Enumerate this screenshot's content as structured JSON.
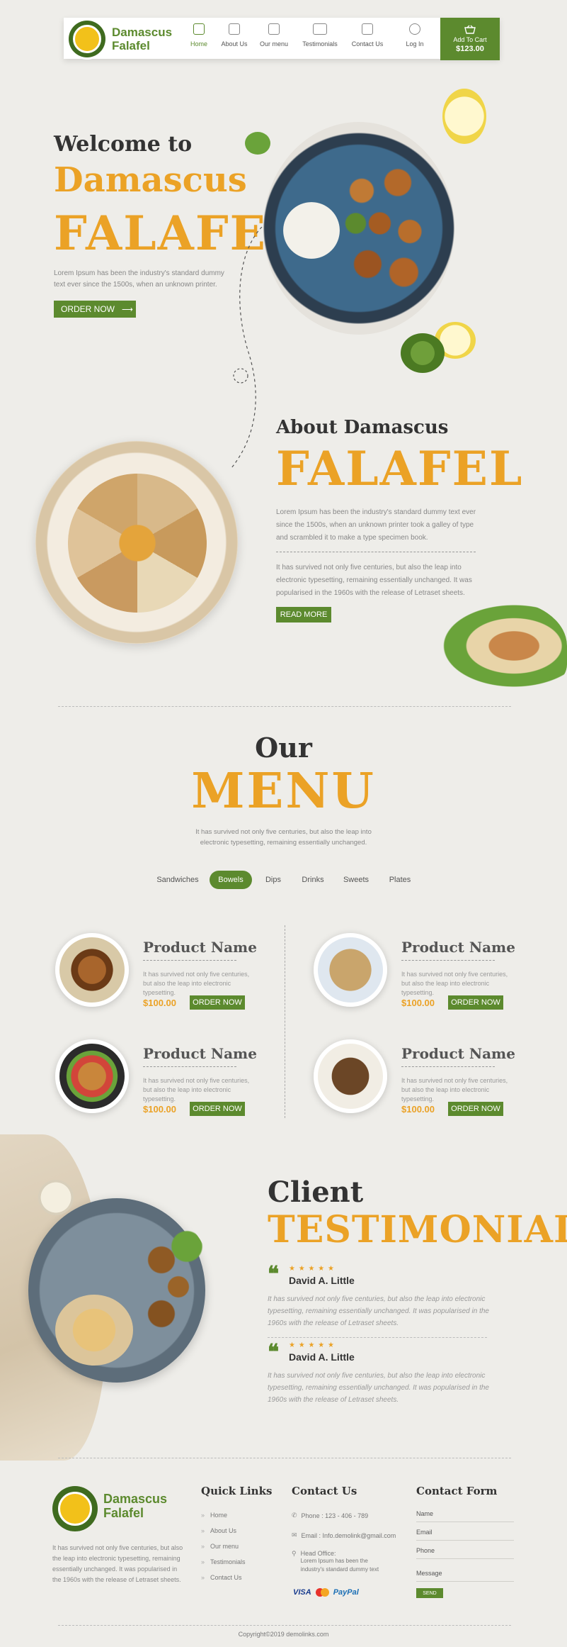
{
  "brand": {
    "name_line1": "Damascus",
    "name_line2": "Falafel"
  },
  "nav": [
    {
      "label": "Home",
      "icon": "home-icon",
      "active": true
    },
    {
      "label": "About Us",
      "icon": "document-icon"
    },
    {
      "label": "Our menu",
      "icon": "menu-jar-icon"
    },
    {
      "label": "Testimonials",
      "icon": "chat-icon"
    },
    {
      "label": "Contact Us",
      "icon": "phone-doc-icon"
    },
    {
      "label": "Log In",
      "icon": "user-circle-icon"
    }
  ],
  "cart": {
    "label": "Add To Cart",
    "amount": "$123.00"
  },
  "hero": {
    "welcome": "Welcome to",
    "title1": "Damascus",
    "title2": "FALAFEL",
    "text": "Lorem Ipsum has been the industry's standard dummy text ever since the 1500s, when an unknown printer.",
    "button": "ORDER NOW"
  },
  "about": {
    "heading": "About Damascus",
    "title": "FALAFEL",
    "text1": "Lorem Ipsum has been the industry's standard dummy text ever since the 1500s, when an unknown printer took a galley of type and scrambled it to make a type specimen book.",
    "text2": "It has survived not only five centuries, but also the leap into electronic typesetting, remaining essentially unchanged. It was popularised in the 1960s with the release of Letraset sheets.",
    "button": "READ MORE"
  },
  "menu": {
    "heading": "Our",
    "title": "MENU",
    "text": "It has survived not only five centuries, but also the leap into electronic typesetting, remaining essentially unchanged.",
    "tabs": [
      "Sandwiches",
      "Bowels",
      "Dips",
      "Drinks",
      "Sweets",
      "Plates"
    ],
    "active_tab": "Bowels",
    "products": [
      {
        "name": "Product Name",
        "desc": "It has survived not only five centuries, but also the leap into electronic typesetting.",
        "price": "$100.00",
        "button": "ORDER NOW"
      },
      {
        "name": "Product Name",
        "desc": "It has survived not only five centuries, but also the leap into electronic typesetting.",
        "price": "$100.00",
        "button": "ORDER NOW"
      },
      {
        "name": "Product Name",
        "desc": "It has survived not only five centuries, but also the leap into electronic typesetting.",
        "price": "$100.00",
        "button": "ORDER NOW"
      },
      {
        "name": "Product Name",
        "desc": "It has survived not only five centuries, but also the leap into electronic typesetting.",
        "price": "$100.00",
        "button": "ORDER NOW"
      }
    ]
  },
  "testimonials": {
    "heading": "Client",
    "title": "TESTIMONIALS",
    "items": [
      {
        "stars": "★ ★ ★ ★ ★",
        "name": "David A. Little",
        "text": "It has survived not only five centuries, but also the leap into electronic typesetting, remaining essentially unchanged. It was popularised in the 1960s with the release of Letraset sheets."
      },
      {
        "stars": "★ ★ ★ ★ ★",
        "name": "David A. Little",
        "text": "It has survived not only five centuries, but also the leap into electronic typesetting, remaining essentially unchanged. It was popularised in the 1960s with the release of Letraset sheets."
      }
    ]
  },
  "footer": {
    "about": "It has survived not only five centuries, but also the leap into electronic typesetting, remaining essentially unchanged. It was popularised in the 1960s with the release of Letraset sheets.",
    "quick_links_title": "Quick Links",
    "quick_links": [
      "Home",
      "About Us",
      "Our menu",
      "Testimonials",
      "Contact Us"
    ],
    "contact_title": "Contact Us",
    "phone": "Phone : 123 - 406 - 789",
    "email": "Email : Info.demolink@gmail.com",
    "office_label": "Head Office:",
    "office_text": "Lorem Ipsum has been the industry's standard dummy text",
    "payments": [
      "VISA",
      "mastercard",
      "PayPal"
    ],
    "form_title": "Contact Form",
    "form_fields": [
      "Name",
      "Email",
      "Phone",
      "Message"
    ],
    "send": "SEND",
    "copyright": "Copyright©2019 demolinks.com"
  },
  "colors": {
    "green": "#5c8a2e",
    "orange": "#eba226",
    "background": "#eeede9"
  }
}
